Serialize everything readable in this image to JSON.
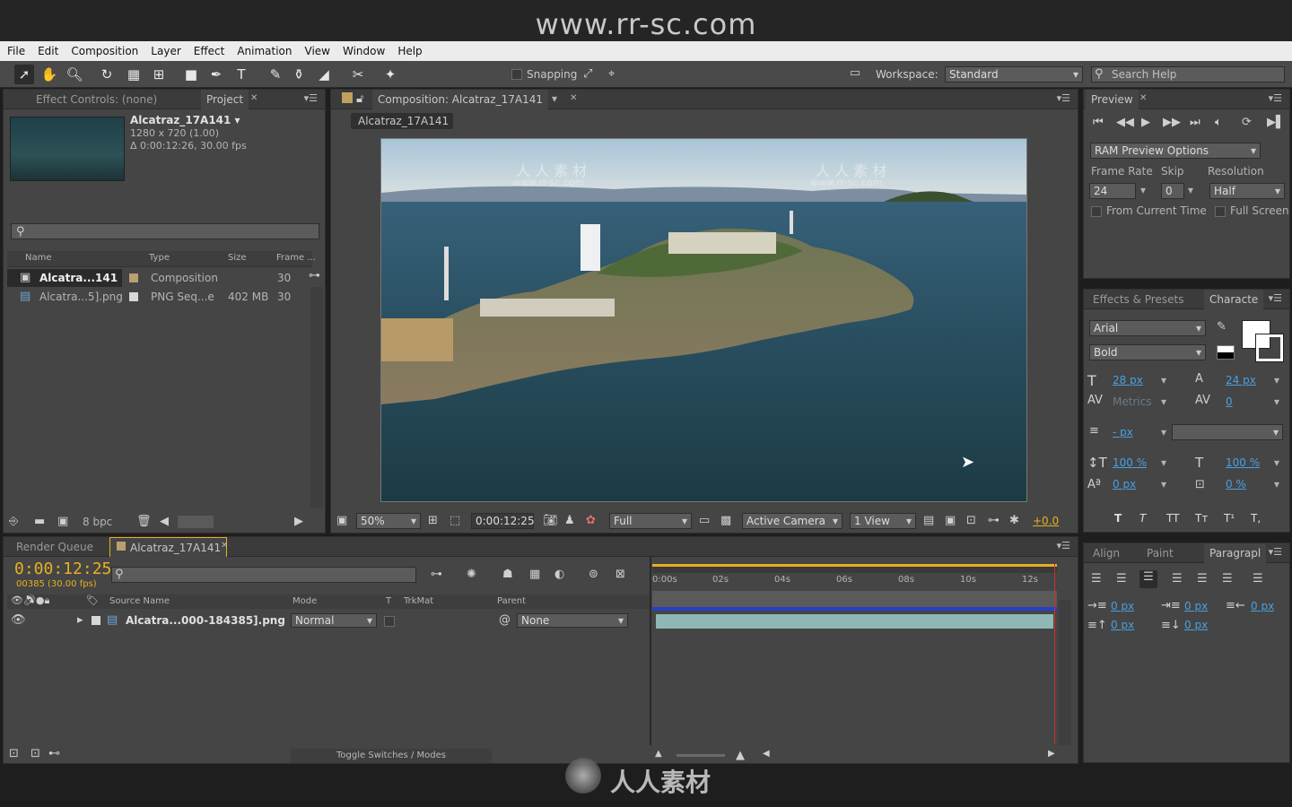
{
  "watermark": "www.rr-sc.com",
  "bottom_logo": "人人素材",
  "menu": [
    "File",
    "Edit",
    "Composition",
    "Layer",
    "Effect",
    "Animation",
    "View",
    "Window",
    "Help"
  ],
  "toolbar": {
    "snapping": "Snapping",
    "workspace_label": "Workspace:",
    "workspace_value": "Standard",
    "search_placeholder": "Search Help"
  },
  "project": {
    "effect_controls_tab": "Effect Controls: (none)",
    "project_tab": "Project",
    "item_name": "Alcatraz_17A141 ▾",
    "item_size": "1280 x 720 (1.00)",
    "item_duration": "Δ 0:00:12:26, 30.00 fps",
    "col_name": "Name",
    "col_type": "Type",
    "col_size": "Size",
    "col_frame": "Frame ...",
    "rows": [
      {
        "name": "Alcatra...141",
        "type": "Composition",
        "size": "",
        "frame": "30"
      },
      {
        "name": "Alcatra...5].png",
        "type": "PNG Seq...e",
        "size": "402 MB",
        "frame": "30"
      }
    ],
    "bpc": "8 bpc"
  },
  "comp": {
    "tab": "Composition: Alcatraz_17A141",
    "crumb": "Alcatraz_17A141",
    "zoom": "50%",
    "timecode": "0:00:12:25",
    "resolution": "Full",
    "camera": "Active Camera",
    "views": "1 View",
    "exposure": "+0.0"
  },
  "preview": {
    "tab": "Preview",
    "ram_options": "RAM Preview Options",
    "frame_rate_label": "Frame Rate",
    "skip_label": "Skip",
    "resolution_label": "Resolution",
    "frame_rate": "24",
    "skip": "0",
    "resolution": "Half",
    "from_current": "From Current Time",
    "full_screen": "Full Screen"
  },
  "character": {
    "effects_tab": "Effects & Presets",
    "char_tab": "Characte",
    "font": "Arial",
    "style": "Bold",
    "size": "28 px",
    "leading": "24 px",
    "kerning": "Metrics",
    "tracking": "0",
    "stroke": "- px",
    "vscale": "100 %",
    "hscale": "100 %",
    "baseline": "0 px",
    "tsume": "0 %",
    "styles": [
      "T",
      "T",
      "TT",
      "Tт",
      "T¹",
      "T,"
    ]
  },
  "paragraph": {
    "align_tab": "Align",
    "paint_tab": "Paint",
    "para_tab": "Paragrapl",
    "indent_left": "0 px",
    "indent_first": "0 px",
    "indent_right": "0 px",
    "space_before": "0 px",
    "space_after": "0 px"
  },
  "timeline": {
    "render_tab": "Render Queue",
    "comp_tab": "Alcatraz_17A141",
    "timecode": "0:00:12:25",
    "frames": "00385 (30.00 fps)",
    "col_source": "Source Name",
    "col_mode": "Mode",
    "col_t": "T",
    "col_trkmat": "TrkMat",
    "col_parent": "Parent",
    "layer_name": "Alcatra...000-184385].png",
    "layer_mode": "Normal",
    "layer_parent": "None",
    "toggle": "Toggle Switches / Modes",
    "ruler": [
      "0:00s",
      "02s",
      "04s",
      "06s",
      "08s",
      "10s",
      "12s"
    ],
    "playhead_fraction": 0.993
  },
  "site_marks": [
    "人 人 素 材",
    "www.rr-sc.com"
  ]
}
